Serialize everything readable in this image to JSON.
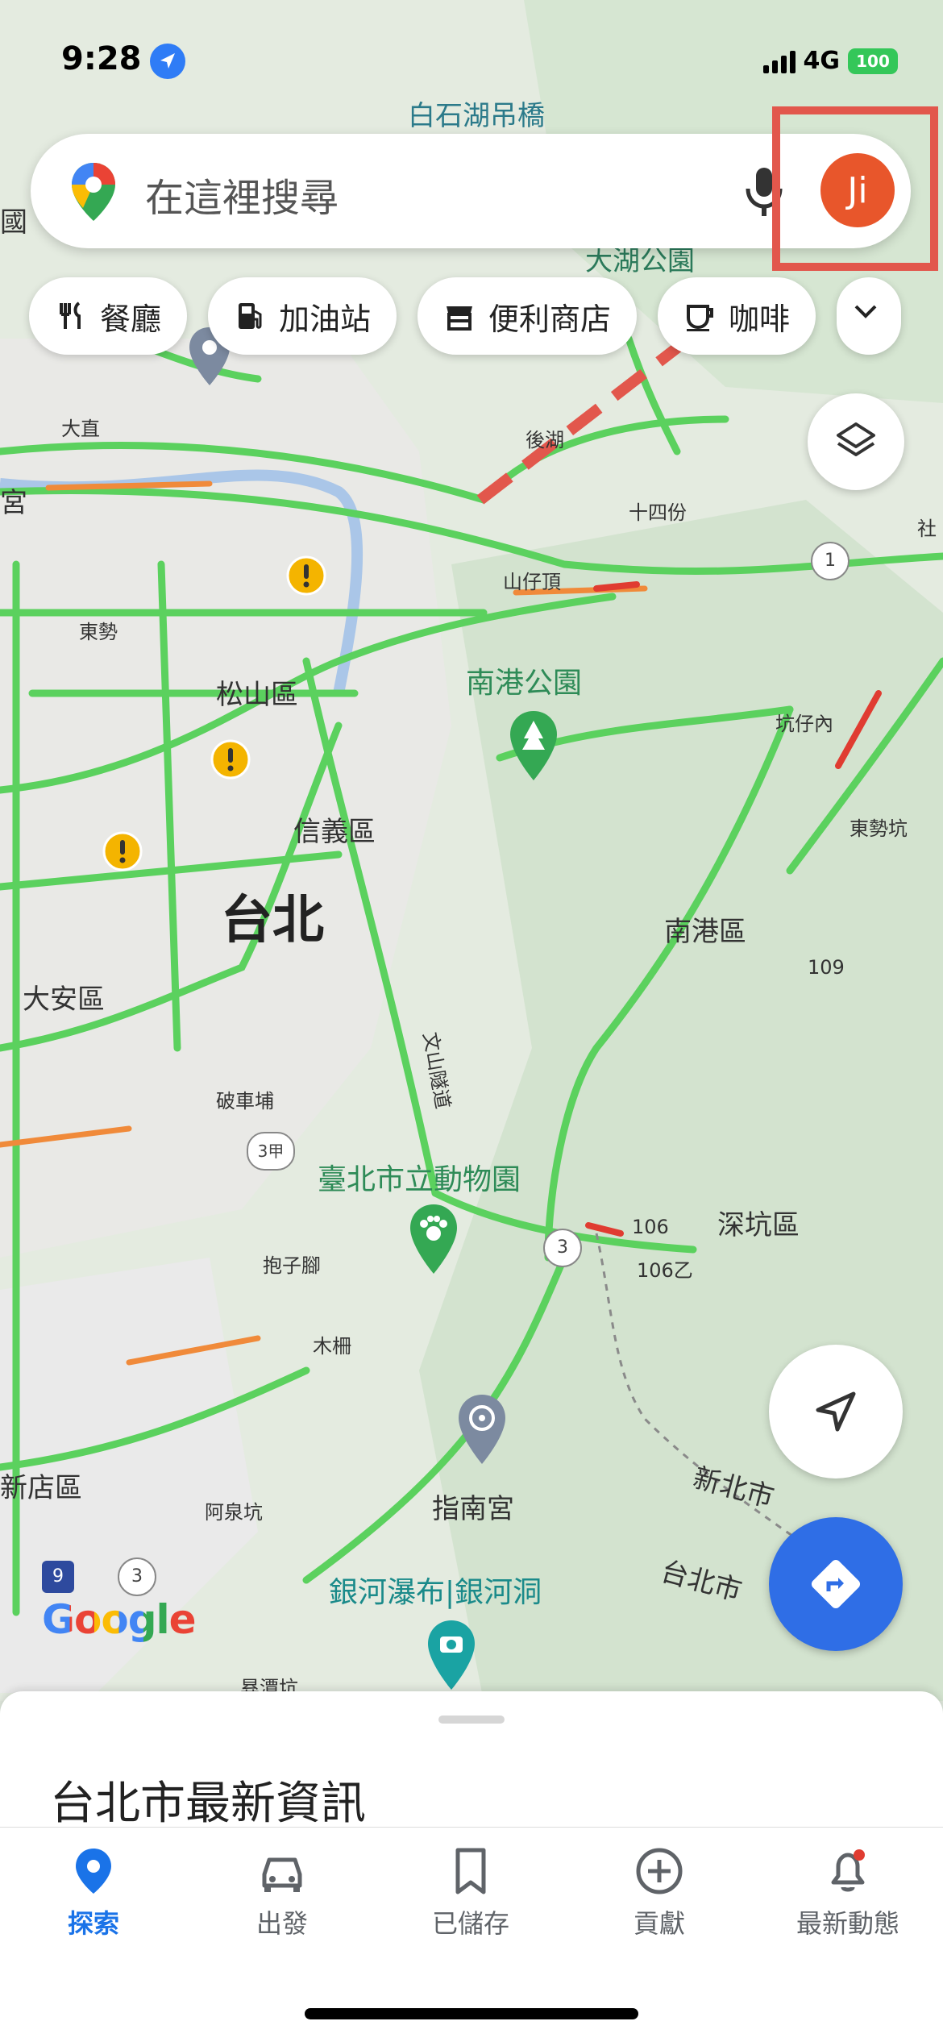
{
  "status_bar": {
    "time": "9:28",
    "network": "4G",
    "battery": "100"
  },
  "search": {
    "placeholder": "在這裡搜尋",
    "avatar_initials": "Ji"
  },
  "chips": [
    {
      "label": "餐廳",
      "icon": "restaurant-icon"
    },
    {
      "label": "加油站",
      "icon": "gas-station-icon"
    },
    {
      "label": "便利商店",
      "icon": "store-icon"
    },
    {
      "label": "咖啡",
      "icon": "coffee-icon"
    }
  ],
  "map_labels": {
    "baishihu": "白石湖吊橋",
    "guo": "國",
    "dahu_park": "大湖公園",
    "dazhi": "大直",
    "gong": "宮",
    "houhu": "後湖",
    "shisifen": "十四份",
    "shanzaiding": "山仔頂",
    "she": "社",
    "dongshi": "東勢",
    "songshan": "松山區",
    "nangang_park": "南港公園",
    "kengzainei": "坑仔內",
    "xinyi": "信義區",
    "dongshikeng": "東勢坑",
    "taipei": "台北",
    "nangang": "南港區",
    "daan": "大安區",
    "wenshan_tunnel": "文山隧道",
    "pochepu": "破車埔",
    "zoo": "臺北市立動物園",
    "shenkeng": "深坑區",
    "baozijiao": "抱子腳",
    "muzha": "木柵",
    "zhinan_temple": "指南宮",
    "xinbei_city": "新北市",
    "taipei_city": "台北市",
    "xindian": "新店區",
    "aquankeng": "阿泉坑",
    "waterfall": "銀河瀑布|銀河洞",
    "shengtankeng": "昪潭坑",
    "r1": "1",
    "r3": "3",
    "r3a": "3甲",
    "r106": "106",
    "r106b": "106乙",
    "r109": "109",
    "r9": "9"
  },
  "google_logo": "Google",
  "sheet": {
    "title": "台北市最新資訊"
  },
  "nav": [
    {
      "label": "探索",
      "icon": "explore-pin-icon",
      "active": true
    },
    {
      "label": "出發",
      "icon": "car-icon",
      "active": false
    },
    {
      "label": "已儲存",
      "icon": "bookmark-icon",
      "active": false
    },
    {
      "label": "貢獻",
      "icon": "add-circle-icon",
      "active": false
    },
    {
      "label": "最新動態",
      "icon": "bell-icon",
      "active": false
    }
  ],
  "colors": {
    "accent": "#1a73e8",
    "avatar": "#e8562b",
    "highlight": "#e2574c",
    "traffic_green": "#5bd15e",
    "traffic_orange": "#f08a3a",
    "traffic_red": "#e03c31"
  }
}
